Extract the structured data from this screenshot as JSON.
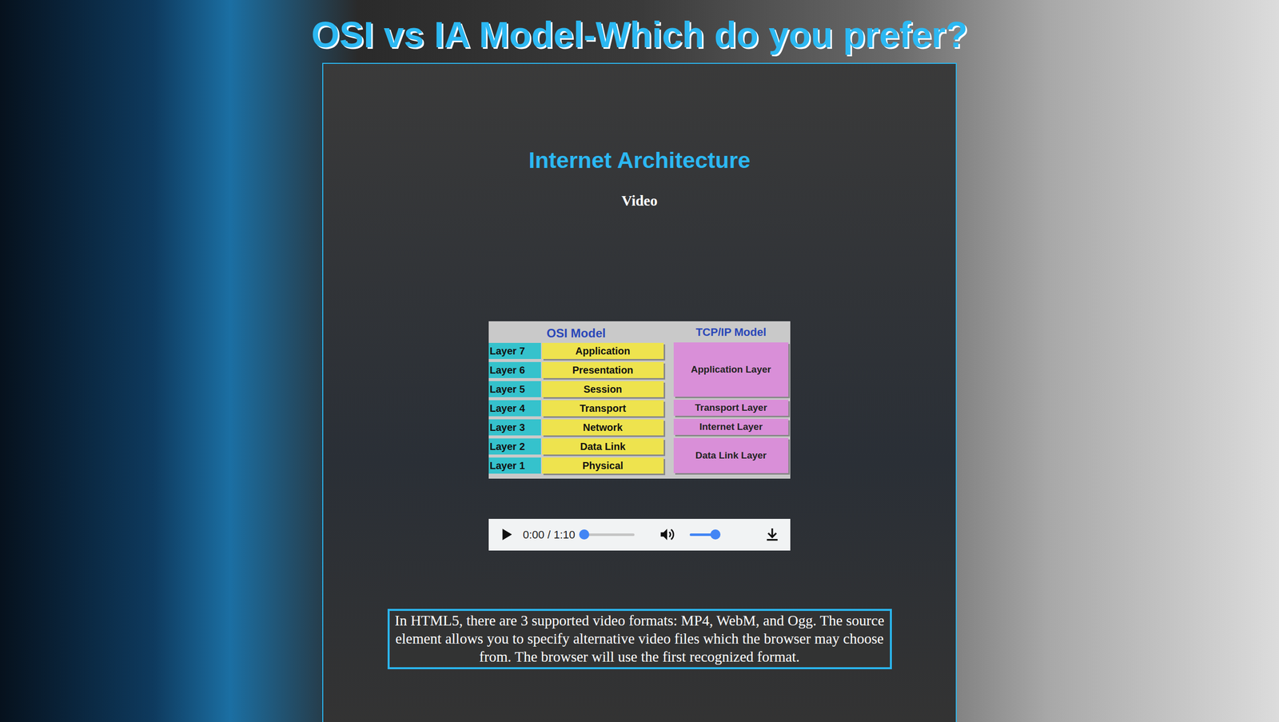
{
  "title": "OSI vs IA Model-Which do you prefer?",
  "panel": {
    "heading": "Internet Architecture",
    "subheading": "Video"
  },
  "diagram": {
    "osi_title": "OSI Model",
    "tcpip_title": "TCP/IP Model",
    "osi_layers": [
      {
        "number": "Layer 7",
        "name": "Application"
      },
      {
        "number": "Layer 6",
        "name": "Presentation"
      },
      {
        "number": "Layer 5",
        "name": "Session"
      },
      {
        "number": "Layer 4",
        "name": "Transport"
      },
      {
        "number": "Layer 3",
        "name": "Network"
      },
      {
        "number": "Layer 2",
        "name": "Data Link"
      },
      {
        "number": "Layer 1",
        "name": "Physical"
      }
    ],
    "tcpip_layers": [
      "Application Layer",
      "Transport Layer",
      "Internet Layer",
      "Data Link Layer"
    ]
  },
  "player": {
    "time": "0:00 / 1:10",
    "progress": 0.0,
    "volume": 0.85,
    "muted": false,
    "playing": false
  },
  "caption": "In HTML5, there are 3 supported video formats: MP4, WebM, and Ogg. The source element allows you to specify alternative video files which the browser may choose from. The browser will use the first recognized format."
}
